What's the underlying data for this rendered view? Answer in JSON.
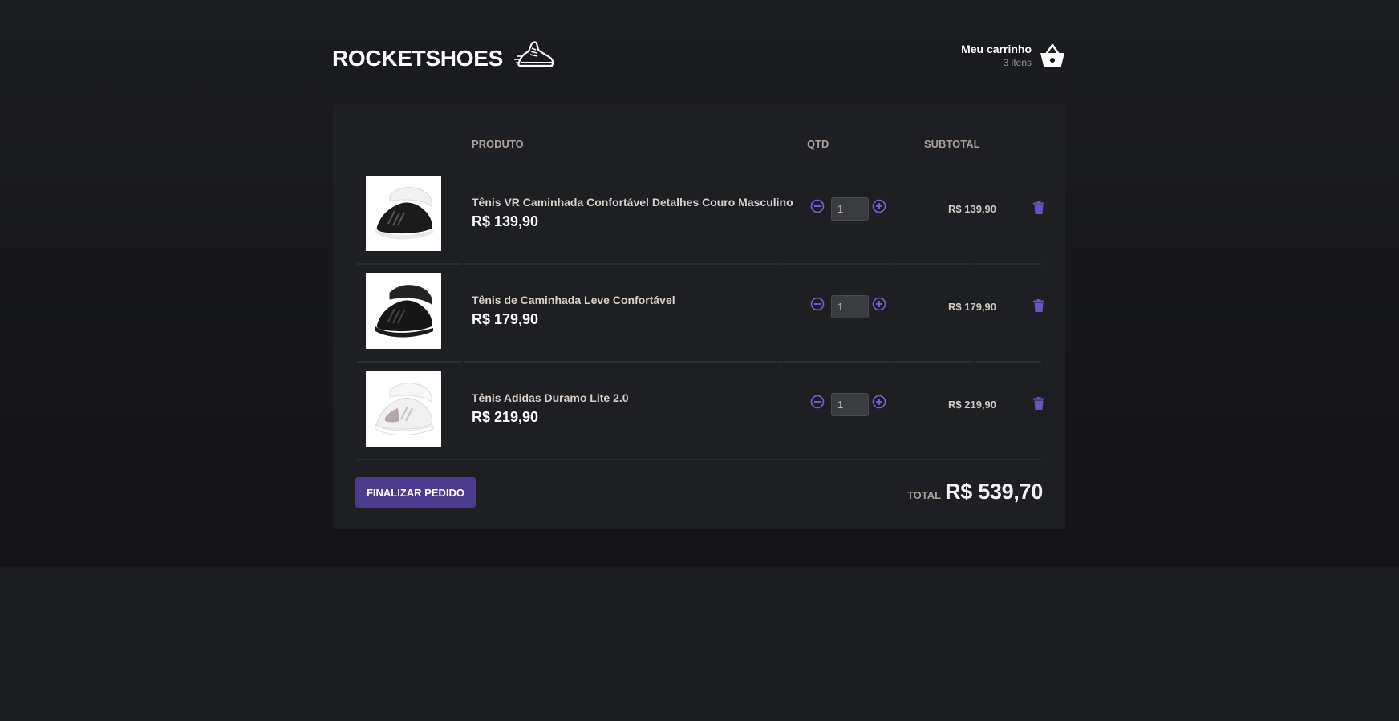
{
  "header": {
    "logo_text": "ROCKETSHOES",
    "cart_title": "Meu carrinho",
    "cart_count": "3 itens"
  },
  "table": {
    "col_product": "PRODUTO",
    "col_qty": "QTD",
    "col_subtotal": "SUBTOTAL"
  },
  "items": [
    {
      "title": "Tênis VR Caminhada Confortável Detalhes Couro Masculino",
      "price": "R$ 139,90",
      "qty": "1",
      "subtotal": "R$ 139,90",
      "shoe_color": "#1a1a1a",
      "sole_color": "#f0f0f0"
    },
    {
      "title": "Tênis de Caminhada Leve Confortável",
      "price": "R$ 179,90",
      "qty": "1",
      "subtotal": "R$ 179,90",
      "shoe_color": "#161616",
      "sole_color": "#1c1c1c"
    },
    {
      "title": "Tênis Adidas Duramo Lite 2.0",
      "price": "R$ 219,90",
      "qty": "1",
      "subtotal": "R$ 219,90",
      "shoe_color": "#f2f2f2",
      "sole_color": "#ffffff"
    }
  ],
  "footer": {
    "finish_label": "FINALIZAR PEDIDO",
    "total_label": "TOTAL",
    "total_value": "R$ 539,70"
  },
  "colors": {
    "accent": "#4c3a91",
    "icon_accent": "#7a62d6"
  },
  "icons": {
    "logo": "running-shoe-icon",
    "cart": "basket-icon",
    "decrease": "minus-circle-icon",
    "increase": "plus-circle-icon",
    "remove": "trash-icon"
  }
}
